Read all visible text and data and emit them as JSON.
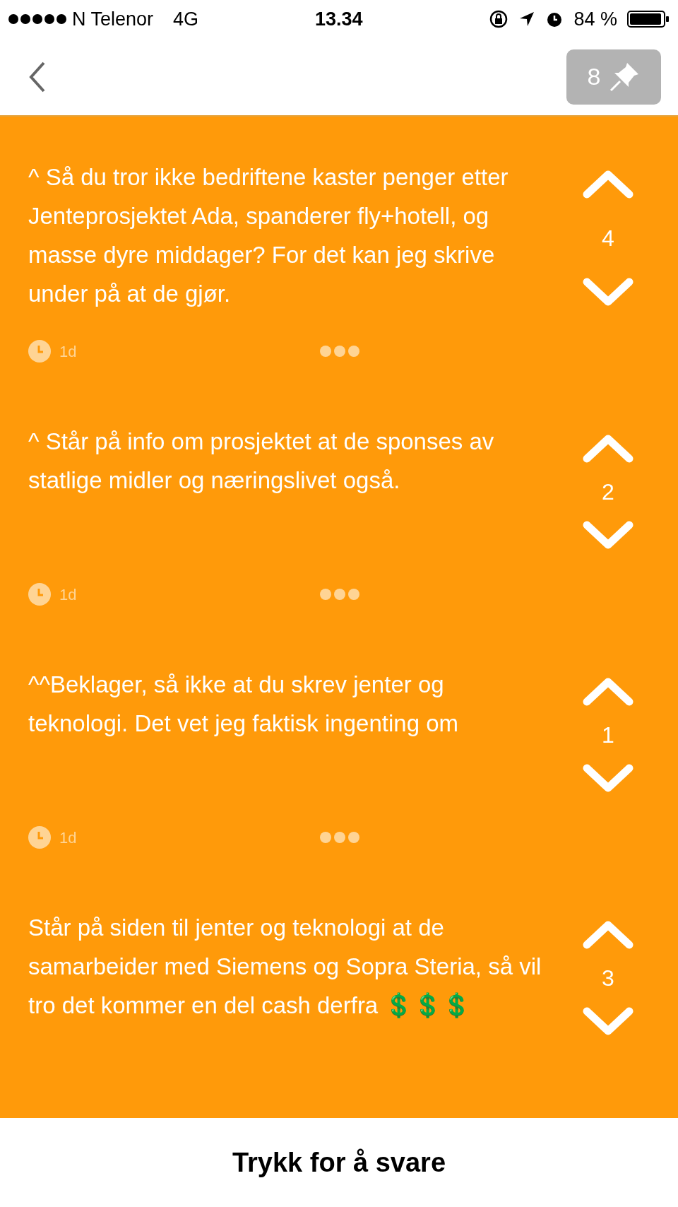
{
  "status_bar": {
    "carrier": "N Telenor",
    "network": "4G",
    "time": "13.34",
    "battery": "84 %"
  },
  "header": {
    "pin_count": "8"
  },
  "posts": [
    {
      "text": "^ Så du tror ikke bedriftene kaster penger etter Jenteprosjektet Ada, spanderer fly+hotell, og masse dyre middager? For det kan jeg skrive under på at de gjør.",
      "votes": "4",
      "age": "1d"
    },
    {
      "text": "^ Står på info om prosjektet  at de sponses av statlige midler og næringslivet også.",
      "votes": "2",
      "age": "1d"
    },
    {
      "text": "^^Beklager, så ikke at du skrev jenter og teknologi. Det vet jeg faktisk ingenting om",
      "votes": "1",
      "age": "1d"
    },
    {
      "text": "Står på siden til jenter og teknologi at de samarbeider med Siemens og Sopra Steria, så vil tro det kommer en del cash derfra",
      "emoji": "💲💲💲",
      "votes": "3"
    }
  ],
  "reply_bar": {
    "label": "Trykk for å svare"
  }
}
